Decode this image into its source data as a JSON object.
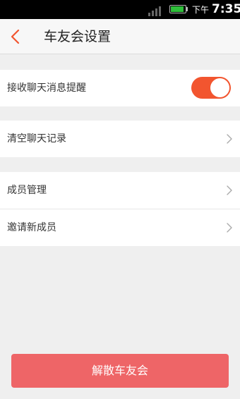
{
  "status_bar": {
    "ampm": "下午",
    "time": "7:35",
    "battery_color": "#2fbf3a",
    "icons": [
      "signal-icon",
      "battery-charging-icon"
    ]
  },
  "header": {
    "title": "车友会设置",
    "back_icon": "chevron-left-icon",
    "accent_color": "#f2552f"
  },
  "settings": {
    "chat_notify": {
      "label": "接收聊天消息提醒",
      "enabled": true
    },
    "clear_history": {
      "label": "清空聊天记录"
    },
    "member_manage": {
      "label": "成员管理"
    },
    "invite_member": {
      "label": "邀请新成员"
    }
  },
  "footer": {
    "dissolve_label": "解散车友会",
    "button_color": "#ee6567"
  }
}
